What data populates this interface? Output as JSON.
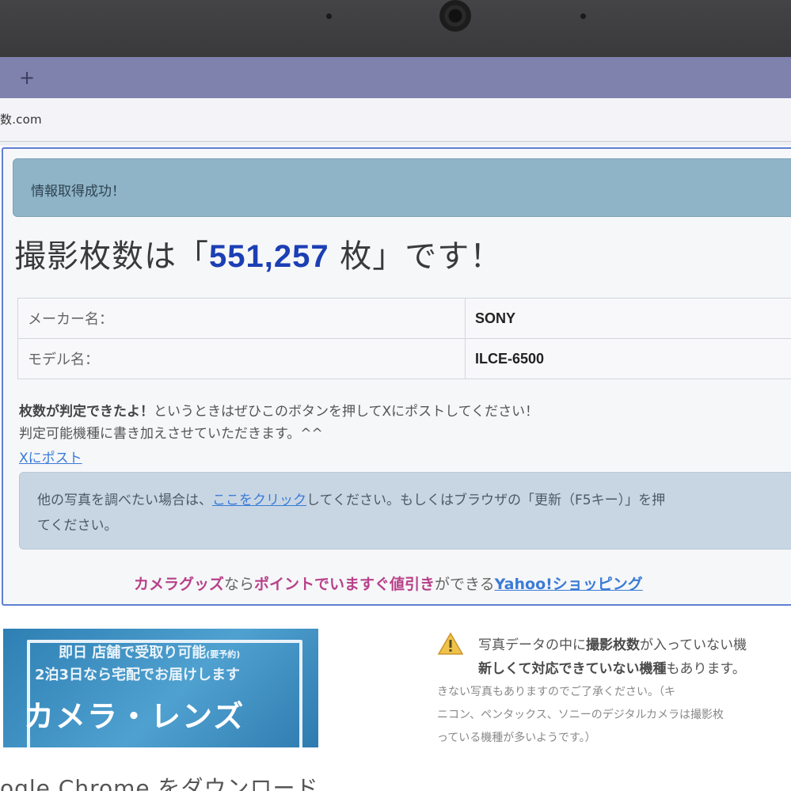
{
  "browser": {
    "new_tab": "+",
    "address": "数.com"
  },
  "alert_success": "情報取得成功！",
  "headline": {
    "prefix": "撮影枚数は「",
    "count": "551,257",
    "suffix": " 枚」です！"
  },
  "info_table": [
    {
      "key": "メーカー名：",
      "value": "SONY"
    },
    {
      "key": "モデル名：",
      "value": "ILCE-6500"
    }
  ],
  "note": {
    "bold": "枚数が判定できたよ！",
    "line1_rest": "というときはぜひこのボタンを押してXにポストしてください！",
    "line2": "判定可能機種に書き加えさせていただきます。^^"
  },
  "x_post_link": "Xにポスト",
  "alert_info": {
    "before_link": "他の写真を調べたい場合は、",
    "link": "ここをクリック",
    "after_link": "してください。もしくはブラウザの「更新（F5キー）」を押",
    "line2": "てください。"
  },
  "promo": {
    "part1": "カメラグッズ",
    "part2": "なら",
    "part3": "ポイントでいますぐ値引き",
    "part4": "ができる",
    "link": "Yahoo!ショッピング"
  },
  "banner": {
    "line1": "即日 店舗で受取り可能",
    "line1_small": "(要予約)",
    "line2": "2泊3日なら宅配でお届けします",
    "line3": "カメラ・レンズ"
  },
  "warning": {
    "line1_a": "写真データの中に",
    "line1_b": "撮影枚数",
    "line1_c": "が入っていない機",
    "line2_a": "新しくて対応できていない機種",
    "line2_b": "もあります。",
    "sub1": "きない写真もありますのでご了承ください。（キ",
    "sub2": "ニコン、ペンタックス、ソニーのデジタルカメラは撮影枚",
    "sub3": "っている機種が多いようです。）"
  },
  "footer_heading": "ogle Chrome をダウンロード",
  "colors": {
    "tab_strip": "#7f82ad",
    "success_alert": "#8fb4c7",
    "info_alert": "#c8d6e4",
    "count_blue": "#1b3fb4",
    "link_blue": "#3b7bd6",
    "promo_magenta": "#b8418a"
  },
  "icons": [
    "plus-icon",
    "warning-icon",
    "camera-lens"
  ]
}
